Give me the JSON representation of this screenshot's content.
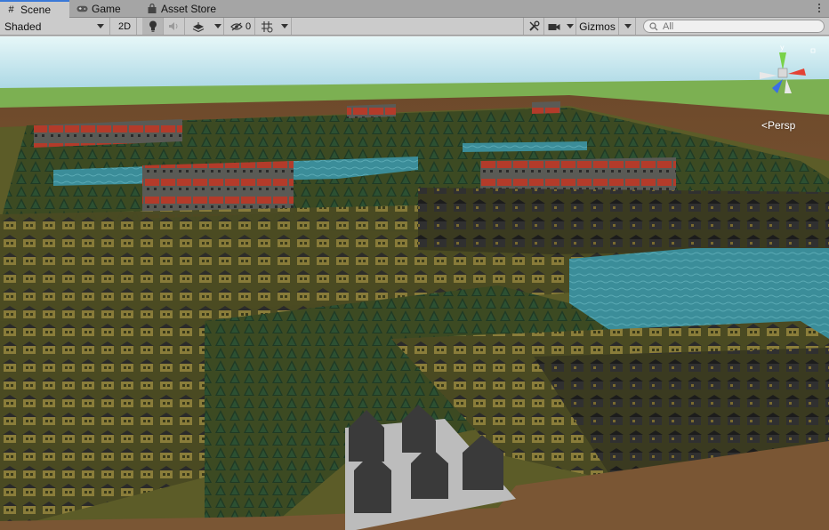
{
  "tabs": [
    {
      "label": "Scene",
      "icon": "hash-icon",
      "active": true
    },
    {
      "label": "Game",
      "icon": "gamepad-icon",
      "active": false
    },
    {
      "label": "Asset Store",
      "icon": "shopping-bag-icon",
      "active": false
    }
  ],
  "toolbar": {
    "draw_mode": "Shaded",
    "mode_2d": "2D",
    "hidden_count": "0",
    "gizmos_label": "Gizmos",
    "search_placeholder": "All"
  },
  "scene": {
    "projection_label": "<Persp"
  },
  "colors": {
    "accent": "#3a79d8",
    "sky_top": "#d9f1f6",
    "sky_bottom": "#8fc9dc",
    "distant_ground": "#7cb052",
    "dirt": "#7a5634",
    "grass": "#6b6b2a",
    "water": "#3b8d99",
    "roof_red": "#b23a2a",
    "house_wall": "#8a7a3a",
    "tree": "#1e3a24"
  }
}
